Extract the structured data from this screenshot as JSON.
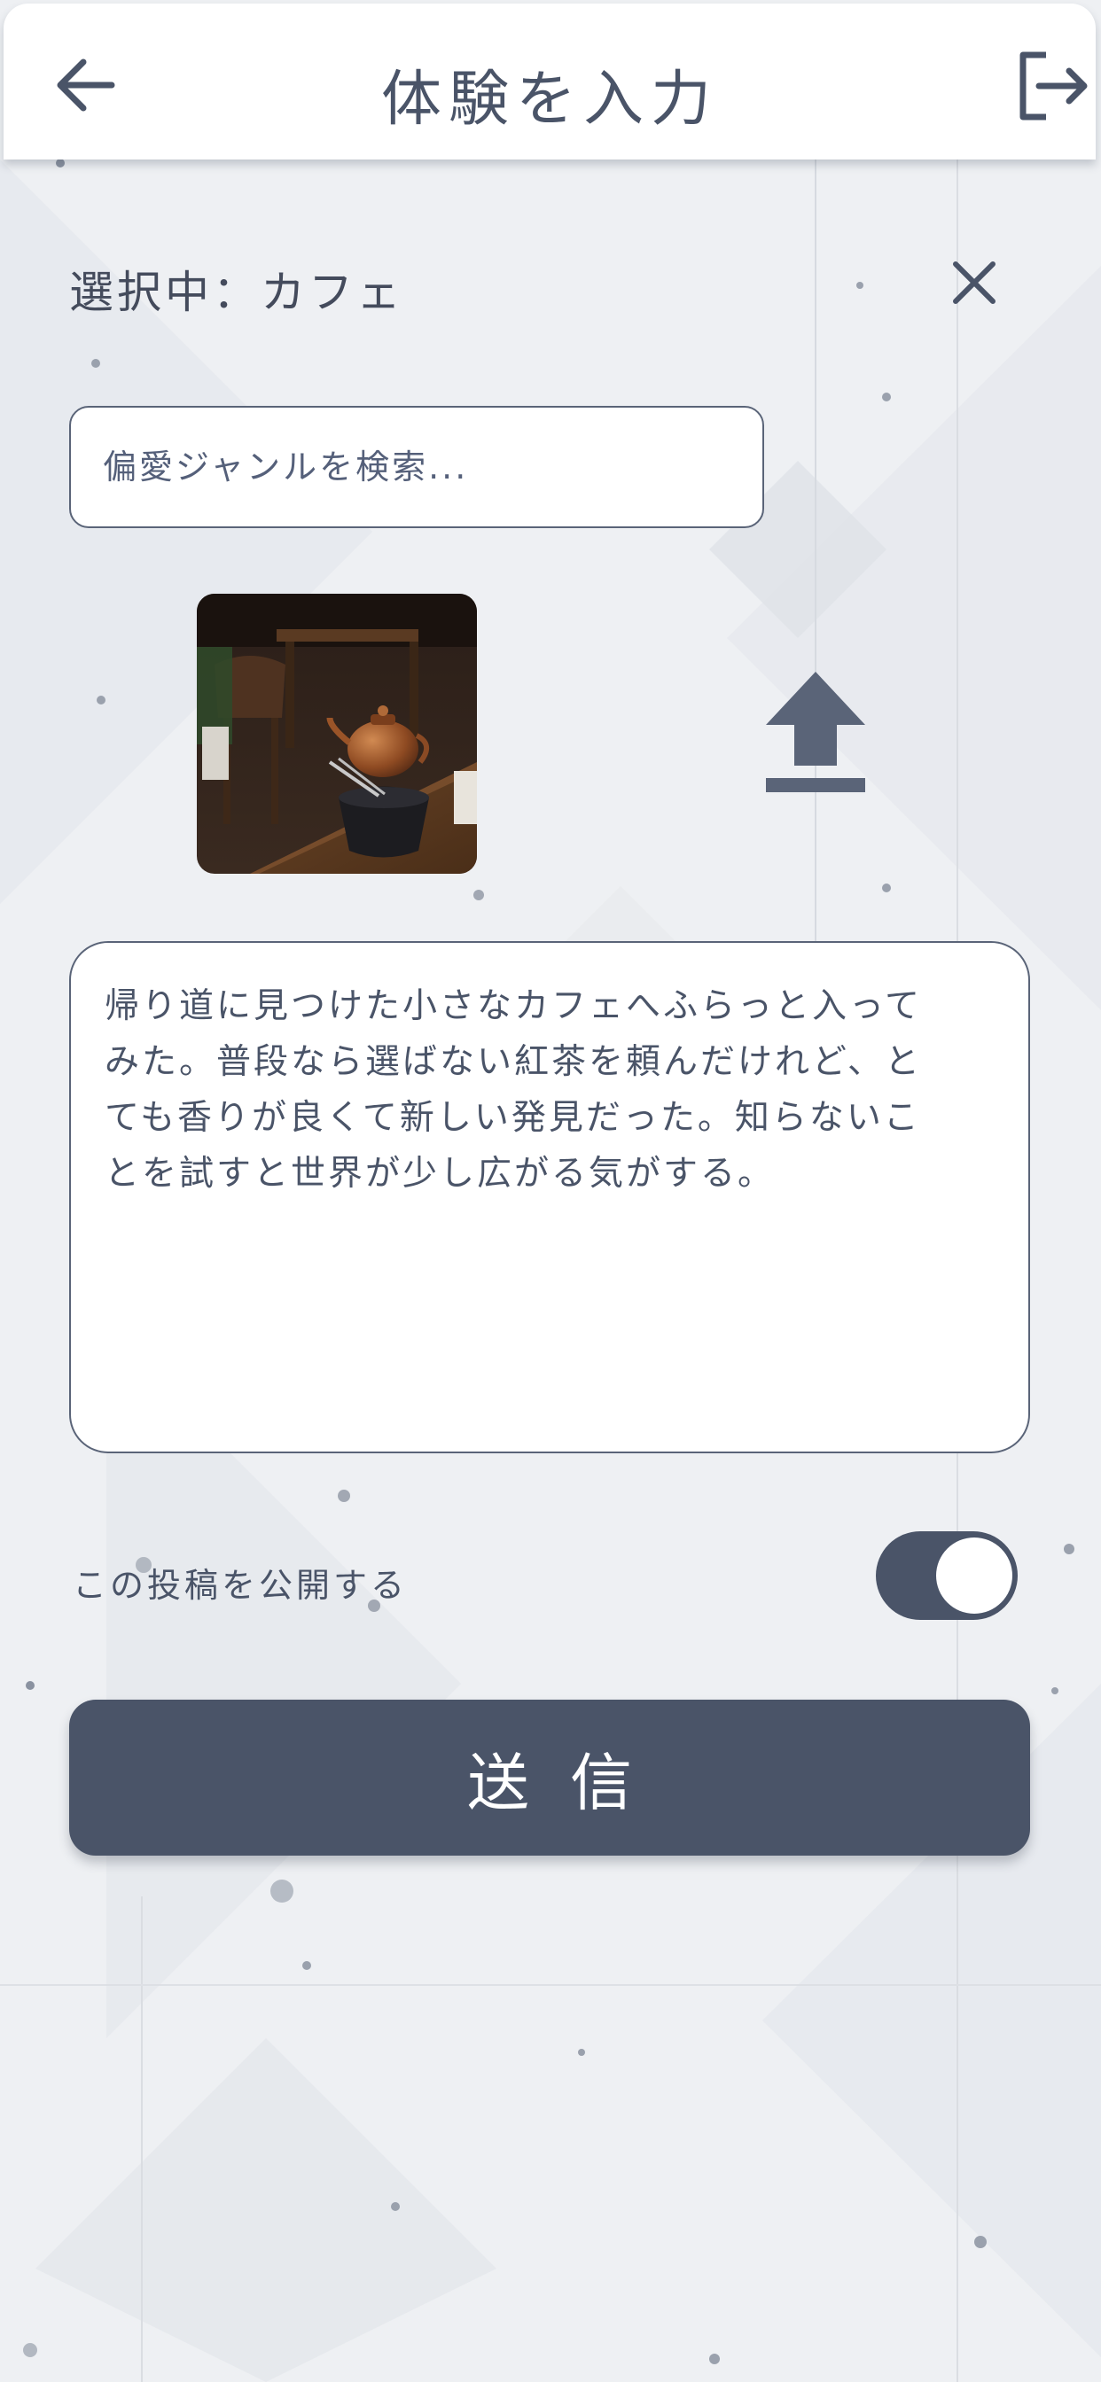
{
  "header": {
    "title": "体験を入力",
    "back_icon": "arrow-left-icon",
    "logout_icon": "logout-icon"
  },
  "selected": {
    "label": "選択中：カフェ",
    "close_icon": "close-icon"
  },
  "search": {
    "placeholder": "偏愛ジャンルを検索...",
    "value": ""
  },
  "photo": {
    "subject": "cafe-teapot-photo"
  },
  "upload": {
    "icon": "upload-icon"
  },
  "post": {
    "text": "帰り道に見つけた小さなカフェへふらっと入って\nみた。普段なら選ばない紅茶を頼んだけれど、と\nても香りが良くて新しい発見だった。知らないこ\nとを試すと世界が少し広がる気がする。"
  },
  "visibility": {
    "label": "この投稿を公開する",
    "enabled": true
  },
  "submit": {
    "label": "送信"
  },
  "colors": {
    "primary": "#4a5468",
    "border": "#5a6478",
    "background": "#eef0f3",
    "surface": "#ffffff"
  }
}
